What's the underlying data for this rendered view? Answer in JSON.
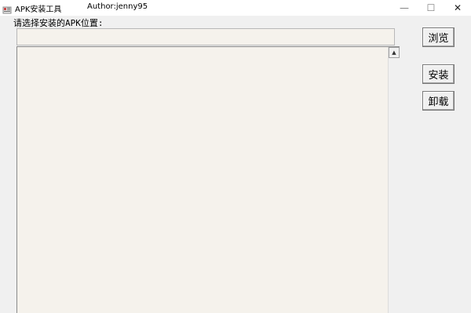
{
  "window": {
    "title": "APK安装工具",
    "author": "Author:jenny95",
    "minimize": "—",
    "maximize": "☐",
    "close": "✕"
  },
  "form": {
    "prompt": "请选择安装的APK位置:",
    "path_value": ""
  },
  "buttons": {
    "browse": "浏览",
    "install": "安装",
    "uninstall": "卸载"
  },
  "output": {
    "text": ""
  },
  "icons": {
    "app": "app-icon",
    "scroll_up": "▲"
  }
}
